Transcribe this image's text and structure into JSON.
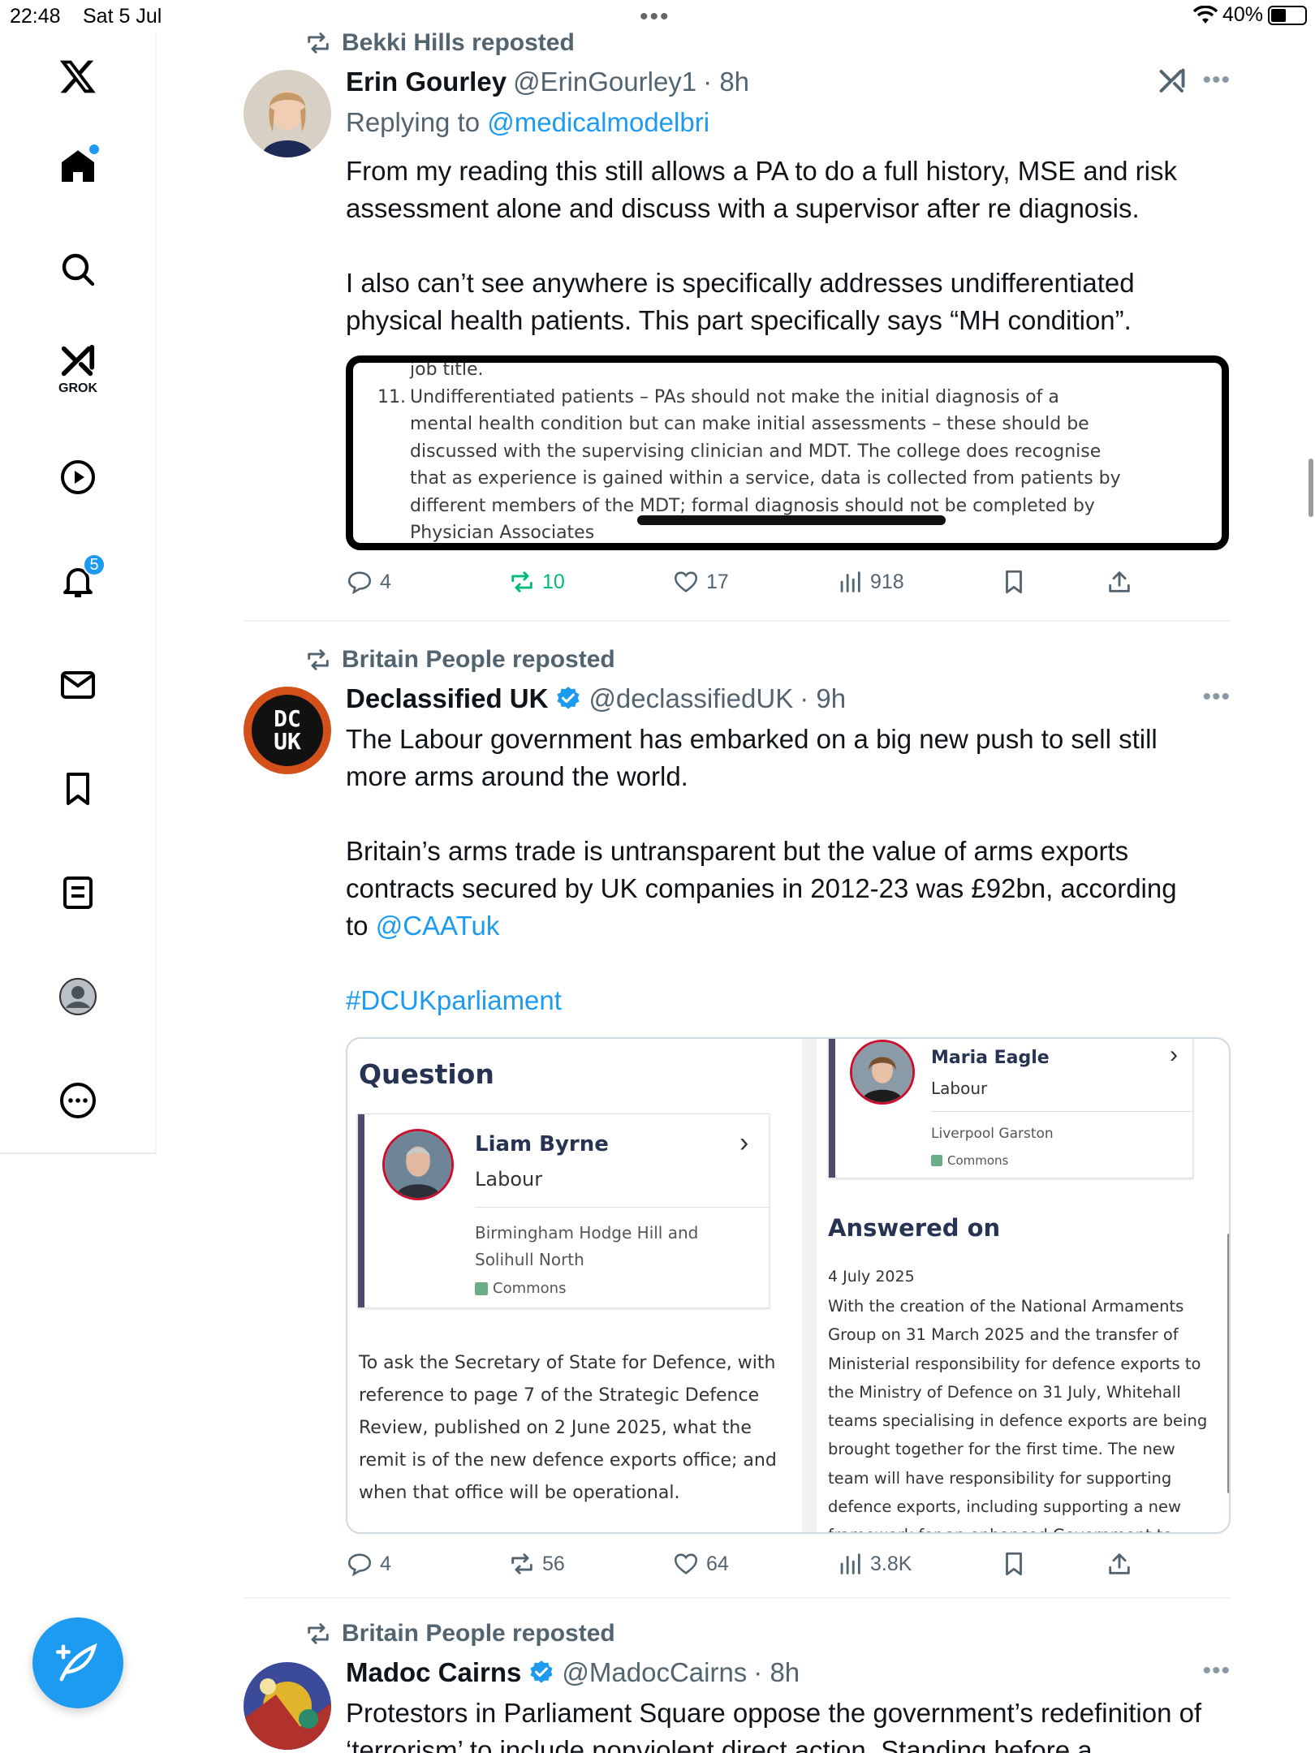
{
  "status_bar": {
    "time": "22:48",
    "date": "Sat 5 Jul",
    "battery": "40%",
    "battery_level": 0.4
  },
  "sidebar": {
    "grok_label": "GROK",
    "notifications_count": "5",
    "items": [
      "home",
      "search",
      "grok",
      "videos",
      "notifications",
      "messages",
      "bookmarks",
      "lists",
      "profile",
      "more"
    ]
  },
  "feed": {
    "tweets": [
      {
        "reposted_by": "Bekki Hills reposted",
        "name": "Erin Gourley",
        "handle": "@ErinGourley1",
        "time": "· 8h",
        "replying_label": "Replying to ",
        "replying_to": "@medicalmodelbri",
        "paragraphs": [
          "From my reading this still allows a PA to do a full history, MSE and risk assessment alone and discuss with a supervisor after re diagnosis.",
          "I also can’t see anywhere is specifically addresses undifferentiated physical health patients. This part specifically says “MH condition”."
        ],
        "image_text": {
          "top": "job title.",
          "num": "11.",
          "lines": [
            "Undifferentiated patients – PAs should not make the initial diagnosis of a",
            "mental health condition but can make initial assessments – these should be",
            "discussed with the supervising clinician and MDT. The college does recognise",
            "that as experience is gained within a service, data is collected from patients by",
            "different members of the MDT; formal diagnosis should not be completed by",
            "Physician Associates"
          ]
        },
        "stats": {
          "replies": "4",
          "reposts": "10",
          "likes": "17",
          "views": "918"
        }
      },
      {
        "reposted_by": "Britain People reposted",
        "name": "Declassified UK",
        "handle": "@declassifiedUK",
        "time": "· 9h",
        "avatar_text": {
          "line1": "DC",
          "line2": "UK"
        },
        "paragraph1": "The Labour government has embarked on a big new push to sell still more arms around the world.",
        "paragraph2_text": "Britain’s arms trade is untransparent but the value of arms exports contracts secured by UK companies in 2012-23 was £92bn, according to ",
        "paragraph2_link": "@CAATuk",
        "hashtag": "#DCUKparliament",
        "card": {
          "question_title": "Question",
          "question_member": {
            "name": "Liam Byrne",
            "party": "Labour",
            "seat": "Birmingham Hodge Hill and Solihull North",
            "house": "Commons"
          },
          "question_text": "To ask the Secretary of State for Defence, with reference to page 7 of the Strategic Defence Review, published on 2 June 2025, what the remit is of the new defence exports office; and when that office will be operational.",
          "answer_member": {
            "name": "Maria Eagle",
            "party": "Labour",
            "seat": "Liverpool Garston",
            "house": "Commons"
          },
          "answered_title": "Answered on",
          "answered_date": "4 July 2025",
          "answer_text": "With the creation of the National Armaments Group on 31 March 2025 and the transfer of Ministerial responsibility for defence exports to the Ministry of Defence on 31 July, Whitehall teams specialising in defence exports are being brought together for the first time. The new team will have responsibility for supporting defence exports, including supporting a new framework for an enhanced Government to"
        },
        "stats": {
          "replies": "4",
          "reposts": "56",
          "likes": "64",
          "views": "3.8K"
        }
      },
      {
        "reposted_by": "Britain People reposted",
        "name": "Madoc Cairns",
        "handle": "@MadocCairns",
        "time": "· 8h",
        "text": "Protestors in Parliament Square oppose the government’s redefinition of ‘terrorism’ to include nonviolent direct action. Standing before a"
      }
    ]
  },
  "colors": {
    "accent": "#1d9bf0",
    "repost_green": "#00ba7c",
    "muted": "#536471"
  }
}
